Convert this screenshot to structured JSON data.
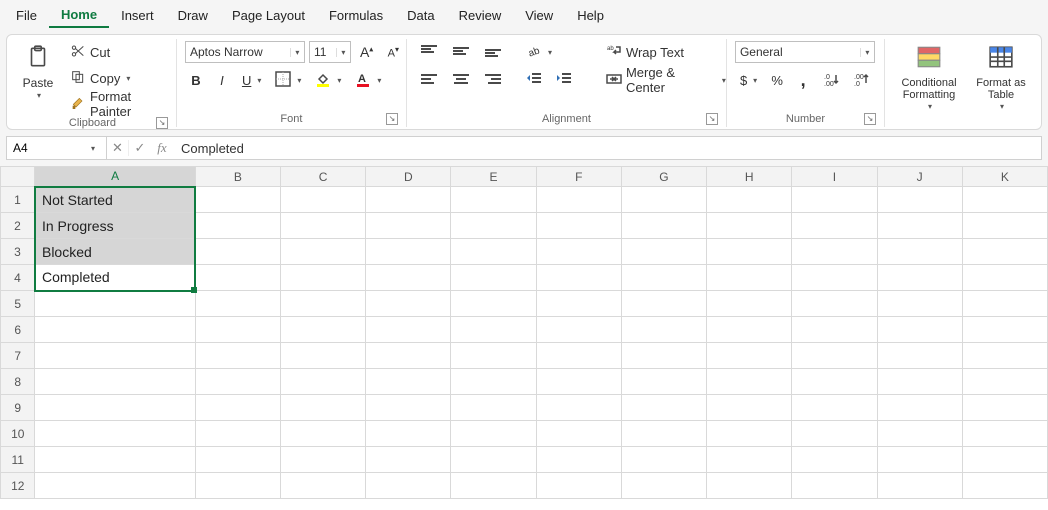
{
  "menu": {
    "items": [
      "File",
      "Home",
      "Insert",
      "Draw",
      "Page Layout",
      "Formulas",
      "Data",
      "Review",
      "View",
      "Help"
    ],
    "active": "Home"
  },
  "ribbon": {
    "clipboard": {
      "label": "Clipboard",
      "paste": "Paste",
      "cut": "Cut",
      "copy": "Copy",
      "format_painter": "Format Painter"
    },
    "font": {
      "label": "Font",
      "name": "Aptos Narrow",
      "size": "11"
    },
    "alignment": {
      "label": "Alignment",
      "wrap_text": "Wrap Text",
      "merge_center": "Merge & Center"
    },
    "number": {
      "label": "Number",
      "format": "General"
    },
    "styles": {
      "conditional_formatting": "Conditional Formatting",
      "format_as_table": "Format as Table"
    }
  },
  "formula_bar": {
    "name_box": "A4",
    "formula": "Completed"
  },
  "grid": {
    "columns": [
      "A",
      "B",
      "C",
      "D",
      "E",
      "F",
      "G",
      "H",
      "I",
      "J",
      "K"
    ],
    "rows": [
      {
        "n": 1,
        "A": "Not Started"
      },
      {
        "n": 2,
        "A": "In Progress"
      },
      {
        "n": 3,
        "A": "Blocked"
      },
      {
        "n": 4,
        "A": "Completed"
      },
      {
        "n": 5
      },
      {
        "n": 6
      },
      {
        "n": 7
      },
      {
        "n": 8
      },
      {
        "n": 9
      },
      {
        "n": 10
      },
      {
        "n": 11
      },
      {
        "n": 12
      }
    ],
    "selection": {
      "range": "A1:A4",
      "active": "A4"
    }
  }
}
